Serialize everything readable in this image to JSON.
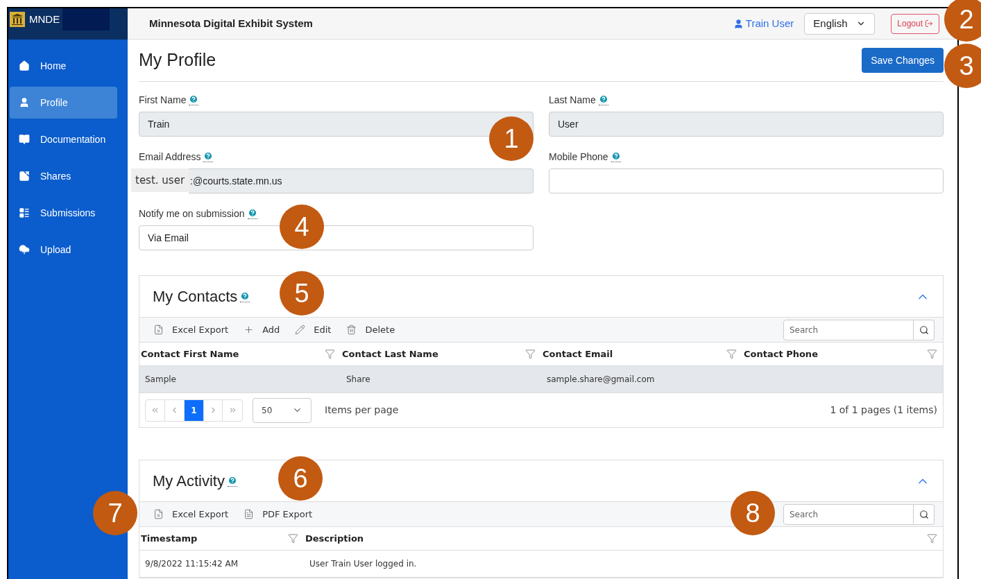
{
  "app": {
    "logo_text": "MNDE",
    "title": "Minnesota Digital Exhibit System"
  },
  "header": {
    "user": "Train User",
    "language": "English",
    "logout": "Logout"
  },
  "sidebar": {
    "items": [
      {
        "label": "Home",
        "selected": false
      },
      {
        "label": "Profile",
        "selected": true
      },
      {
        "label": "Documentation",
        "selected": false
      },
      {
        "label": "Shares",
        "selected": false
      },
      {
        "label": "Submissions",
        "selected": false
      },
      {
        "label": "Upload",
        "selected": false
      }
    ]
  },
  "page_title": "My Profile",
  "save_button": "Save Changes",
  "form": {
    "fields": [
      {
        "label": "First Name",
        "value": "Train",
        "disabled": true
      },
      {
        "label": "Last Name",
        "value": "User",
        "disabled": true
      },
      {
        "label": "Email Address",
        "value": ":@courts.state.mn.us",
        "disabled": true,
        "overlay": "test. user"
      },
      {
        "label": "Mobile Phone",
        "disabled": false
      },
      {
        "label": "Notify me on submission",
        "value": "Via Email",
        "disabled": false
      }
    ]
  },
  "contacts": {
    "title": "My Contacts",
    "expanded": true,
    "toolbar": [
      {
        "kind": "excel",
        "label": "Excel Export"
      },
      {
        "kind": "add",
        "label": "Add"
      },
      {
        "kind": "edit",
        "label": "Edit"
      },
      {
        "kind": "delete",
        "label": "Delete"
      }
    ],
    "search": {
      "placeholder": "Search"
    },
    "columns": [
      "Contact First Name",
      "Contact Last Name",
      "Contact Email",
      "Contact Phone"
    ],
    "rows": [
      {
        "selected": true,
        "cells": [
          "Sample",
          "Share",
          "sample.share@gmail.com",
          ""
        ]
      }
    ],
    "pager": {
      "pages": [
        {
          "label": "1",
          "selected": true
        }
      ],
      "page_size": "50",
      "page_size_label": "Items per page",
      "summary": "1 of 1 pages (1 items)"
    }
  },
  "activity": {
    "title": "My Activity",
    "expanded": true,
    "toolbar": [
      {
        "kind": "excel",
        "label": "Excel Export"
      },
      {
        "kind": "pdf",
        "label": "PDF Export"
      }
    ],
    "search": {
      "placeholder": "Search"
    },
    "columns": [
      "Timestamp",
      "Description"
    ],
    "rows": [
      {
        "selected": false,
        "cells": [
          "9/8/2022 11:15:42 AM",
          "User Train User logged in."
        ]
      }
    ]
  },
  "callouts": [
    "1",
    "2",
    "3",
    "4",
    "5",
    "6",
    "7",
    "8"
  ]
}
